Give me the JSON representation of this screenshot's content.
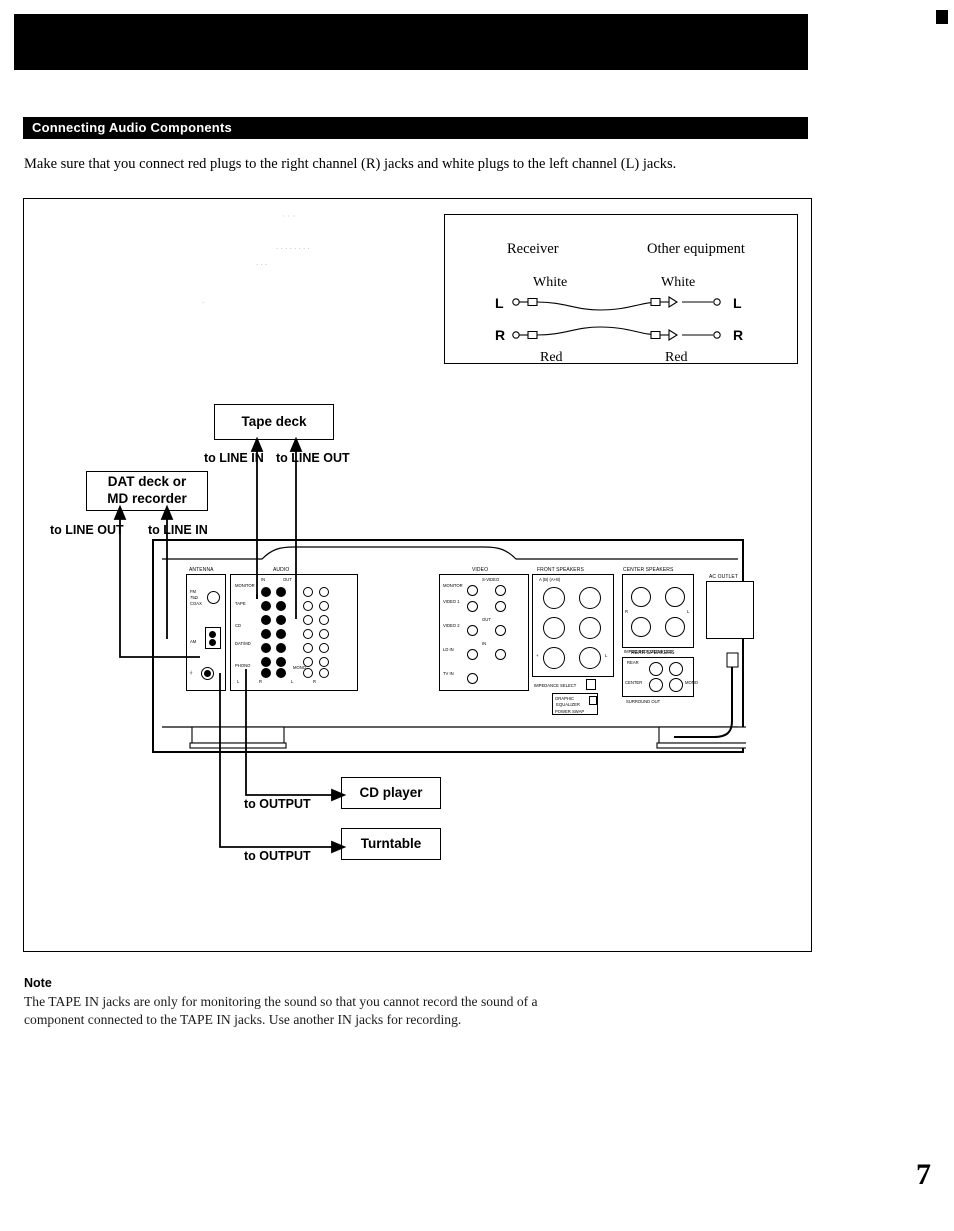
{
  "section": {
    "heading": "Connecting Audio Components",
    "intro": "Make sure that you connect red plugs to the right channel (R) jacks and white plugs to the left channel (L) jacks."
  },
  "legend": {
    "receiver": "Receiver",
    "other_equipment": "Other equipment",
    "white_left": "White",
    "white_right": "White",
    "red_left": "Red",
    "red_right": "Red",
    "l_left": "L",
    "r_left": "R",
    "l_right": "L",
    "r_right": "R"
  },
  "callouts": {
    "tape_deck": "Tape deck",
    "dat_deck": "DAT deck or\nMD recorder",
    "cd_player": "CD player",
    "turntable": "Turntable",
    "to_line_in_tape": "to LINE IN",
    "to_line_out_tape": "to LINE OUT",
    "to_line_out_dat": "to LINE OUT",
    "to_line_in_dat": "to LINE IN",
    "to_output_cd": "to OUTPUT",
    "to_output_turntable": "to OUTPUT"
  },
  "receiver_panel": {
    "antenna_label": "ANTENNA",
    "audio_label": "AUDIO",
    "video_label": "VIDEO",
    "front_speakers": "FRONT   SPEAKERS",
    "front_speakers_sub": "A (B)  (A+B)",
    "center_speakers": "CENTER  SPEAKERS",
    "rear_speakers": "REAR  SPEAKERS",
    "surround_out": "SURROUND OUT",
    "ac_outlet": "AC OUTLET",
    "impedance_use": "IMPEDANCE USE 8-16 Ω",
    "impedance_select": "IMPEDANCE SELECT",
    "power_swap": "POWER SWAP",
    "fm_label": "FM\n75Ω\nCOAX",
    "am_label": "AM",
    "rows": [
      {
        "name": "MONITOR",
        "l": "L",
        "r": "R"
      },
      {
        "name": "TAPE",
        "l": "L",
        "r": "R"
      },
      {
        "name": "CD",
        "l": "L",
        "r": "R"
      },
      {
        "name": "DAT/MD",
        "l": "L",
        "r": "R"
      },
      {
        "name": "PHONO",
        "l": "L",
        "r": "R"
      }
    ],
    "video_rows": [
      {
        "name": "MONITOR"
      },
      {
        "name": "VIDEO 1"
      },
      {
        "name": "VIDEO 2"
      },
      {
        "name": "LD IN"
      },
      {
        "name": "TV IN"
      },
      {
        "name": "OUT"
      },
      {
        "name": "S-VIDEO"
      },
      {
        "name": "IN"
      }
    ],
    "signal_ground": "SIGNAL GND",
    "speaker_terms": [
      "+",
      "-",
      "L",
      "R",
      "A",
      "B"
    ],
    "mono_label": "MONO",
    "center_label": "CENTER"
  },
  "note": {
    "title": "Note",
    "body": "The TAPE IN jacks are only for monitoring the sound so that you cannot record the sound of a component connected to the TAPE IN jacks. Use another IN jacks for recording."
  },
  "page_number": "7"
}
